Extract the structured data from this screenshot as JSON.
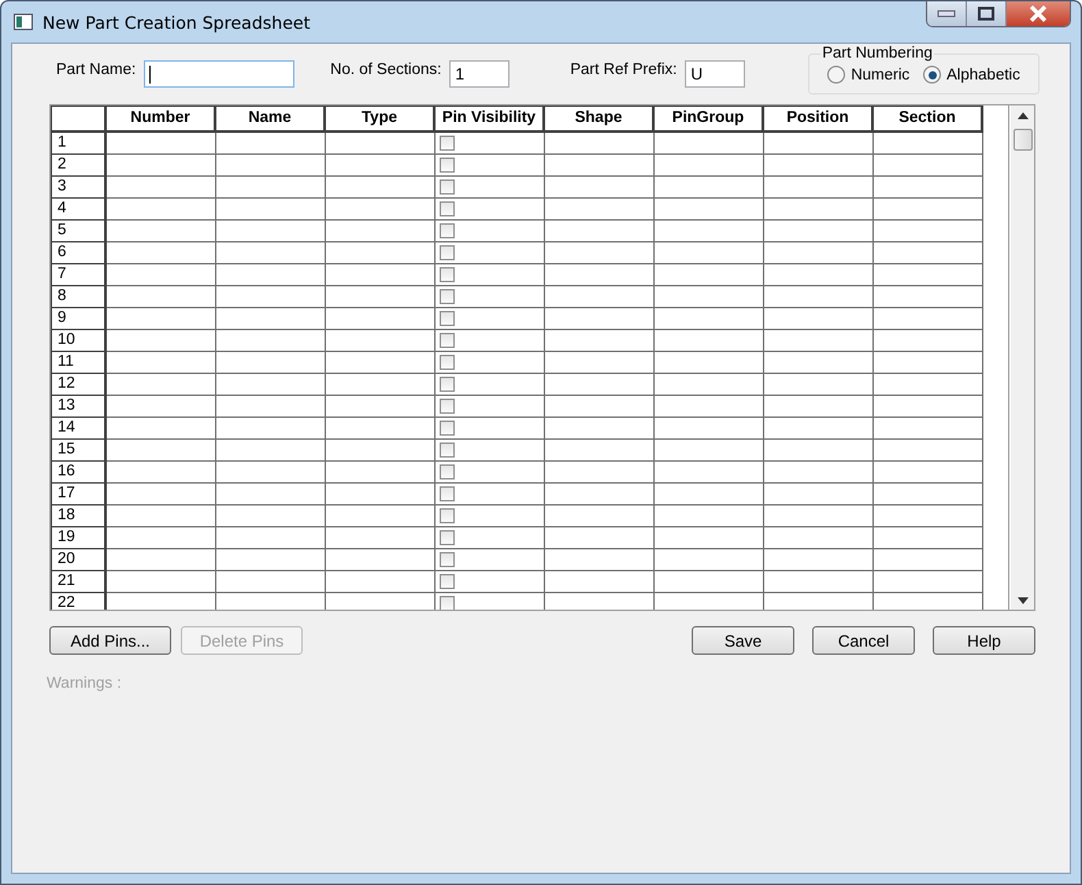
{
  "window": {
    "title": "New Part Creation Spreadsheet"
  },
  "fields": [
    {
      "label": "Part Name:",
      "focused": true
    },
    {
      "label": "No. of Sections:",
      "value": "1",
      "focused": false
    },
    {
      "label": "Part Ref Prefix:",
      "value": "U",
      "focused": false
    }
  ],
  "part_numbering": {
    "title": "Part Numbering",
    "options": [
      {
        "label": "Numeric",
        "selected": false
      },
      {
        "label": "Alphabetic",
        "selected": true
      }
    ]
  },
  "table": {
    "columns": [
      "Number",
      "Name",
      "Type",
      "Pin Visibility",
      "Shape",
      "PinGroup",
      "Position",
      "Section"
    ],
    "rows": [
      {
        "header": "1",
        "pin_visibility": false
      },
      {
        "header": "2",
        "pin_visibility": false
      },
      {
        "header": "3",
        "pin_visibility": false
      },
      {
        "header": "4",
        "pin_visibility": false
      },
      {
        "header": "5",
        "pin_visibility": false
      },
      {
        "header": "6",
        "pin_visibility": false
      },
      {
        "header": "7",
        "pin_visibility": false
      },
      {
        "header": "8",
        "pin_visibility": false
      },
      {
        "header": "9",
        "pin_visibility": false
      },
      {
        "header": "10",
        "pin_visibility": false
      },
      {
        "header": "11",
        "pin_visibility": false
      },
      {
        "header": "12",
        "pin_visibility": false
      },
      {
        "header": "13",
        "pin_visibility": false
      },
      {
        "header": "14",
        "pin_visibility": false
      },
      {
        "header": "15",
        "pin_visibility": false
      },
      {
        "header": "16",
        "pin_visibility": false
      },
      {
        "header": "17",
        "pin_visibility": false
      },
      {
        "header": "18",
        "pin_visibility": false
      },
      {
        "header": "19",
        "pin_visibility": false
      },
      {
        "header": "20",
        "pin_visibility": false
      },
      {
        "header": "21",
        "pin_visibility": false
      },
      {
        "header": "22",
        "pin_visibility": false
      }
    ]
  },
  "buttons_left": [
    {
      "label": "Add Pins...",
      "disabled": false
    },
    {
      "label": "Delete Pins",
      "disabled": true
    }
  ],
  "buttons_right": [
    {
      "label": "Save",
      "disabled": false
    },
    {
      "label": "Cancel",
      "disabled": false
    },
    {
      "label": "Help",
      "disabled": false
    }
  ],
  "warnings_label": "Warnings :"
}
